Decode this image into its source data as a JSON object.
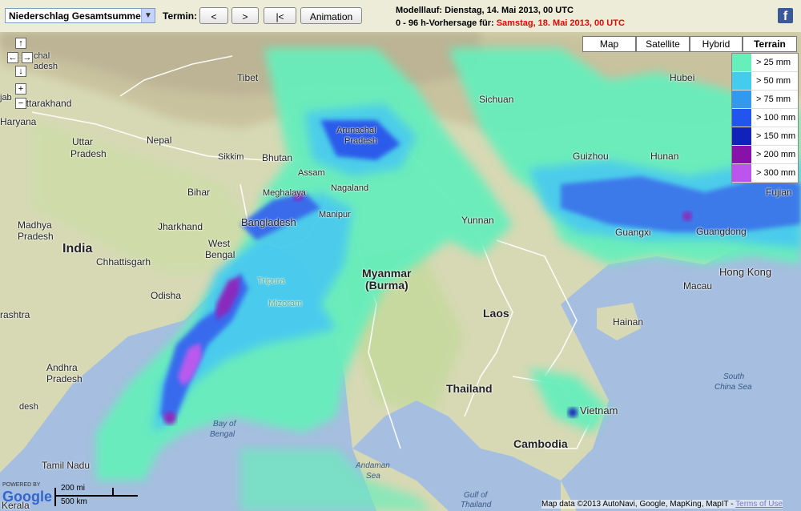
{
  "toolbar": {
    "product_select": "Niederschlag Gesamtsumme",
    "termin_label": "Termin:",
    "prev_label": "<",
    "next_label": ">",
    "first_label": "|<",
    "animation_label": "Animation",
    "modelllauf_line": "Modelllauf: Dienstag, 14. Mai 2013, 00 UTC",
    "forecast_prefix": "0 - 96 h-Vorhersage für: ",
    "forecast_date": "Samstag, 18. Mai 2013, 00 UTC",
    "facebook_icon": "f"
  },
  "map_types": {
    "map": "Map",
    "satellite": "Satellite",
    "hybrid": "Hybrid",
    "terrain": "Terrain",
    "active": "terrain"
  },
  "legend": [
    {
      "label": "> 25 mm",
      "color": "#66eebb"
    },
    {
      "label": "> 50 mm",
      "color": "#44ccee"
    },
    {
      "label": "> 75 mm",
      "color": "#3399ee"
    },
    {
      "label": "> 100 mm",
      "color": "#2255ee"
    },
    {
      "label": "> 150 mm",
      "color": "#1122bb"
    },
    {
      "label": "> 200 mm",
      "color": "#8811aa"
    },
    {
      "label": "> 300 mm",
      "color": "#bb55ee"
    }
  ],
  "labels": {
    "india": "India",
    "tibet": "Tibet",
    "nepal": "Nepal",
    "bhutan": "Bhutan",
    "sikkim": "Sikkim",
    "bangladesh": "Bangladesh",
    "myanmar": "Myanmar",
    "burma": "(Burma)",
    "thailand": "Thailand",
    "laos": "Laos",
    "cambodia": "Cambodia",
    "vietnam": "Vietnam",
    "yunnan": "Yunnan",
    "sichuan": "Sichuan",
    "guizhou": "Guizhou",
    "hunan": "Hunan",
    "hubei": "Hubei",
    "guangxi": "Guangxi",
    "guangdong": "Guangdong",
    "fujian": "Fujian",
    "macau": "Macau",
    "hong_kong": "Hong Kong",
    "hainan": "Hainan",
    "uttarakhand": "Uttarakhand",
    "haryana": "Haryana",
    "uttar": "Uttar",
    "pradesh_up": "Pradesh",
    "bihar": "Bihar",
    "jharkhand": "Jharkhand",
    "west": "West",
    "bengal": "Bengal",
    "madhya": "Madhya",
    "pradesh_mp": "Pradesh",
    "chhattisgarh": "Chhattisgarh",
    "odisha": "Odisha",
    "andhra": "Andhra",
    "pradesh_ap": "Pradesh",
    "tamil_nadu": "Tamil Nadu",
    "kerala": "Kerala",
    "rashtra": "rashtra",
    "assam": "Assam",
    "meghalaya": "Meghalaya",
    "nagaland": "Nagaland",
    "manipur": "Manipur",
    "tripura": "Tripura",
    "mizoram": "Mizoram",
    "arunachal": "Arunachal",
    "pradesh_ar": "Pradesh",
    "chal": "chal",
    "adesh": "adesh",
    "jab": "jab",
    "desh": "desh",
    "bay_of": "Bay of",
    "bengal_bay": "Bengal",
    "andaman": "Andaman",
    "sea_andaman": "Sea",
    "gulf_of": "Gulf of",
    "thailand_gulf": "Thailand",
    "south": "South",
    "china_sea": "China Sea"
  },
  "attribution": {
    "text": "Map data ©2013 AutoNavi, Google, MapKing, MapIT - ",
    "terms": "Terms of Use"
  },
  "scale": {
    "miles": "200 mi",
    "km": "500 km"
  },
  "google": {
    "powered": "POWERED BY",
    "logo": "Google"
  }
}
